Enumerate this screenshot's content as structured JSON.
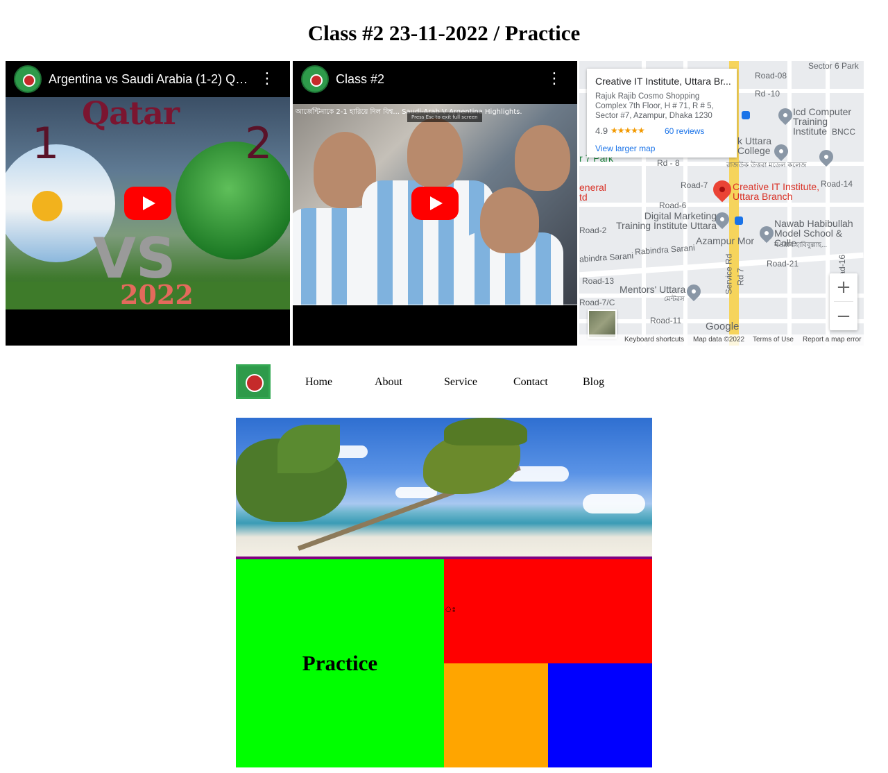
{
  "page": {
    "title": "Class #2 23-11-2022 / Practice"
  },
  "videos": [
    {
      "title": "Argentina vs Saudi Arabia (1-2) Qa...",
      "thumbnail": {
        "brand_word": "Qatar",
        "score_left": "1",
        "score_right": "2",
        "vs": "VS",
        "year": "2022"
      }
    },
    {
      "title": "Class #2",
      "thumbnail": {
        "subtitle_text": "আর্জেন্টিনাকে 2-1 হারিয়ে দিল বিশ্ব... Saudi-Arab V Argentina Highlights.",
        "fullscreen_hint": "Press Esc to exit full screen"
      }
    }
  ],
  "map": {
    "card": {
      "title": "Creative IT Institute, Uttara Br...",
      "address": "Rajuk Rajib Cosmo Shopping Complex 7th Floor, H # 71, R # 5, Sector #7, Azampur, Dhaka 1230",
      "rating": "4.9",
      "stars": "★★★★★",
      "reviews": "60 reviews",
      "larger_map_link": "View larger map"
    },
    "labels": {
      "road08": "Road-08",
      "rd10": "Rd -10",
      "rd8": "Rd - 8",
      "road7": "Road-7",
      "road14": "Road-14",
      "road6": "Road-6",
      "road2": "Road-2",
      "road21": "Road-21",
      "road13": "Road-13",
      "road7c": "Road-7/C",
      "road11": "Road-11",
      "rabindra1": "Rabindra Sarani",
      "rabindra2": "abindra Sarani",
      "service_rd": "Service Rd",
      "rd7": "Rd 7",
      "road16": "Road-16",
      "bncc": "BNCC",
      "icd": "Icd Computer Training Institute",
      "uttara_college": "k Uttara College",
      "uttara_college_bn": "রাজউক উত্তরা মডেল কলেজ",
      "creative_it": "Creative IT Institute, Uttara Branch",
      "digital_marketing": "Digital Marketing Training Institute Uttara",
      "azampur": "Azampur Mor",
      "nawab": "Nawab Habibullah Model School & Colle",
      "nawab_bn": "নওয়াব হাবিবুল্লাহ...",
      "mentors": "Mentors' Uttara",
      "mentors_bn": "মেন্টরস",
      "park": "r 7 Park",
      "eneral": "eneral",
      "td": "td",
      "sector6": "Sector 6 Park"
    },
    "zoom_in": "+",
    "zoom_out": "−",
    "google": "Google",
    "attribution": {
      "shortcuts": "Keyboard shortcuts",
      "data": "Map data ©2022",
      "terms": "Terms of Use",
      "report": "Report a map error"
    }
  },
  "nav": {
    "items": [
      {
        "label": "Home"
      },
      {
        "label": "About"
      },
      {
        "label": "Service"
      },
      {
        "label": "Contact"
      },
      {
        "label": "Blog"
      }
    ]
  },
  "grid": {
    "practice_heading": "Practice",
    "red_glyph": "ঃ"
  },
  "colors": {
    "green": "#00ff00",
    "red": "#ff0000",
    "orange": "#ffa500",
    "blue": "#0000ff",
    "hero_border": "#800080",
    "youtube_red": "#ff0000"
  },
  "icons": [
    "channel-logo-icon",
    "more-vertical-icon",
    "play-icon",
    "map-pin-icon",
    "bus-stop-icon",
    "zoom-in-icon",
    "zoom-out-icon",
    "site-logo-icon"
  ]
}
